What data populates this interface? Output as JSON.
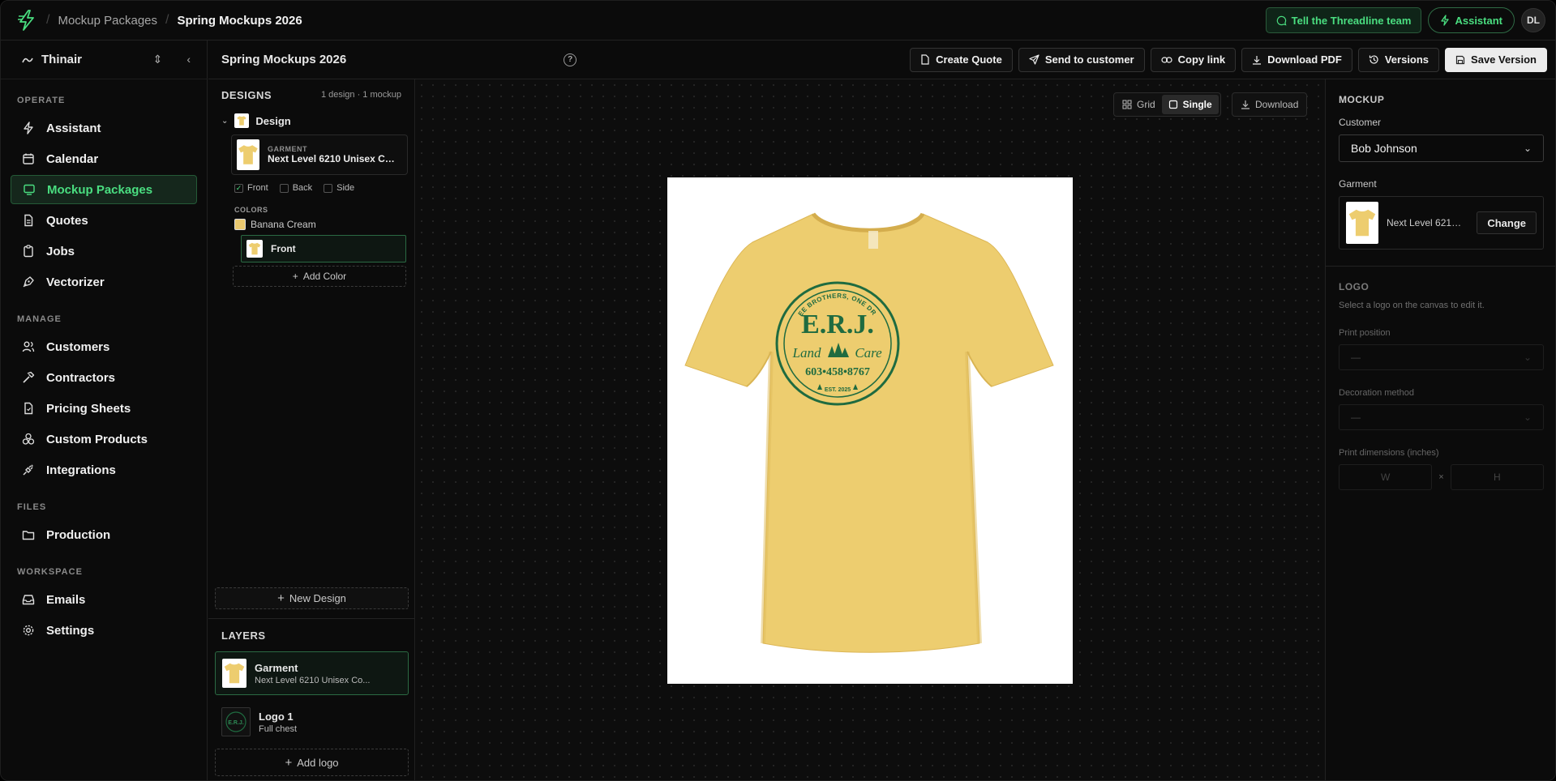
{
  "topbar": {
    "breadcrumb_parent": "Mockup Packages",
    "breadcrumb_current": "Spring Mockups 2026",
    "feedback_label": "Tell the Threadline team",
    "assistant_label": "Assistant",
    "avatar_initials": "DL"
  },
  "sidebar": {
    "workspace_name": "Thinair",
    "sections": {
      "operate": "OPERATE",
      "manage": "MANAGE",
      "files": "FILES",
      "workspace": "WORKSPACE"
    },
    "items": {
      "assistant": "Assistant",
      "calendar": "Calendar",
      "mockup_packages": "Mockup Packages",
      "quotes": "Quotes",
      "jobs": "Jobs",
      "vectorizer": "Vectorizer",
      "customers": "Customers",
      "contractors": "Contractors",
      "pricing_sheets": "Pricing Sheets",
      "custom_products": "Custom Products",
      "integrations": "Integrations",
      "production": "Production",
      "emails": "Emails",
      "settings": "Settings"
    }
  },
  "project": {
    "title": "Spring Mockups 2026",
    "actions": {
      "create_quote": "Create Quote",
      "send_to_customer": "Send to customer",
      "copy_link": "Copy link",
      "download_pdf": "Download PDF",
      "versions": "Versions",
      "save_version": "Save Version"
    }
  },
  "designs": {
    "title": "DESIGNS",
    "meta": "1 design · 1 mockup",
    "design_name": "Design",
    "garment_label": "GARMENT",
    "garment_name": "Next Level 6210 Unisex Cotton...",
    "sides": {
      "front": "Front",
      "back": "Back",
      "side": "Side"
    },
    "colors_label": "COLORS",
    "color_name": "Banana Cream",
    "view_name": "Front",
    "add_color": "Add Color",
    "new_design": "New Design"
  },
  "layers": {
    "title": "LAYERS",
    "garment_title": "Garment",
    "garment_sub": "Next Level 6210 Unisex Co...",
    "logo_title": "Logo 1",
    "logo_sub": "Full chest",
    "add_logo": "Add logo"
  },
  "canvas": {
    "grid_label": "Grid",
    "single_label": "Single",
    "download_label": "Download",
    "shirt_color": "#edcd6f",
    "logo": {
      "arc_top": "THREE BROTHERS, ONE DREAM",
      "initials": "E.R.J.",
      "script_left": "Land",
      "script_right": "Care",
      "phone": "603•458•8767",
      "est": "EST. 2025",
      "color": "#1f6b40"
    }
  },
  "right_panel": {
    "mockup_title": "MOCKUP",
    "customer_label": "Customer",
    "customer_value": "Bob Johnson",
    "garment_label": "Garment",
    "garment_name": "Next Level 6210...",
    "change_label": "Change",
    "logo_title": "LOGO",
    "logo_hint": "Select a logo on the canvas to edit it.",
    "print_position_label": "Print position",
    "print_position_value": "—",
    "decoration_label": "Decoration method",
    "decoration_value": "—",
    "dimensions_label": "Print dimensions (inches)",
    "width_placeholder": "W",
    "height_placeholder": "H",
    "times": "×"
  },
  "colors": {
    "accent": "#4ade80",
    "swatch": "#e9c86f"
  }
}
